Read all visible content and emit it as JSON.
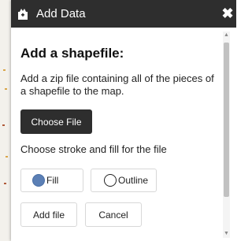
{
  "dialog": {
    "title": "Add Data",
    "title_icon": "add-data-icon",
    "close_icon": "close-icon",
    "close_glyph": "✖"
  },
  "content": {
    "heading": "Add a shapefile:",
    "description": "Add a zip file containing all of the pieces of a shapefile to the map.",
    "choose_file_label": "Choose File",
    "stroke_fill_label": "Choose stroke and fill for the file",
    "options": [
      {
        "label": "Fill",
        "selected": true
      },
      {
        "label": "Outline",
        "selected": false
      }
    ],
    "add_file_label": "Add file",
    "cancel_label": "Cancel"
  },
  "colors": {
    "titlebar": "#2e2e2e",
    "fill_swatch": "#5b7fb5",
    "dark_button": "#2e2e2e"
  }
}
